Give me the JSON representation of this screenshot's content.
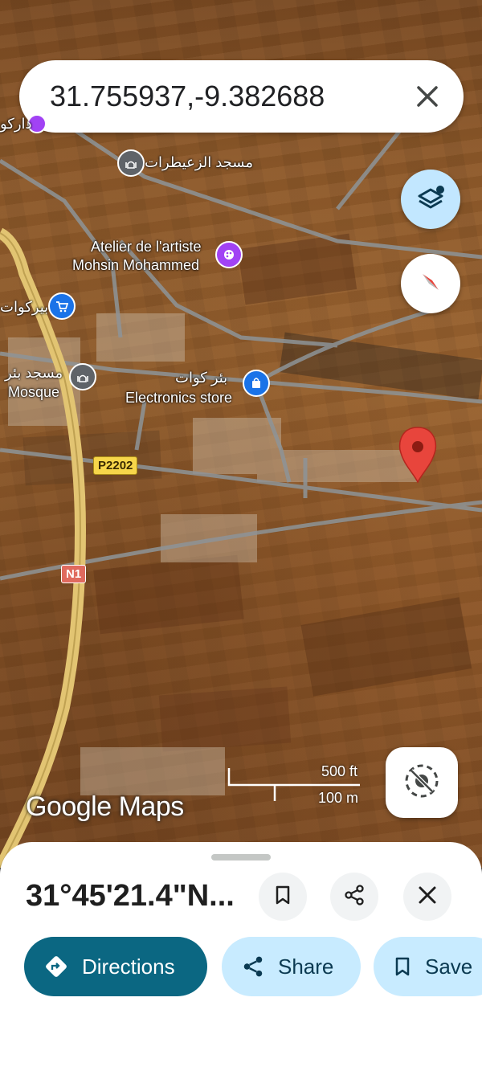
{
  "search": {
    "query": "31.755937,-9.382688"
  },
  "map": {
    "pois": [
      {
        "label": "دارکو",
        "kind": "place"
      },
      {
        "label": "مسجد الزعيطرات",
        "kind": "mosque"
      },
      {
        "label": "Atelier de l'artiste",
        "kind": "art"
      },
      {
        "label": "Mohsin Mohammed",
        "kind": "art"
      },
      {
        "label": "بيركوات",
        "kind": "shopping"
      },
      {
        "label": "مسجد بئر",
        "kind": "mosque"
      },
      {
        "label": "Mosque",
        "kind": "mosque"
      },
      {
        "label": "بئر كوات",
        "kind": "store"
      },
      {
        "label": "Electronics store",
        "kind": "store"
      }
    ],
    "roads": [
      {
        "ref": "P2202"
      },
      {
        "ref": "N1"
      }
    ],
    "scale": {
      "imperial": "500 ft",
      "metric": "100 m"
    },
    "attribution": "Google Maps",
    "pin_color": "#e8453c"
  },
  "sheet": {
    "title": "31°45'21.4\"N...",
    "actions": {
      "directions": "Directions",
      "share": "Share",
      "save": "Save"
    }
  },
  "colors": {
    "accent": "#0b6782",
    "tonal": "#c8ebff",
    "layers_fab": "#c2e7ff"
  }
}
